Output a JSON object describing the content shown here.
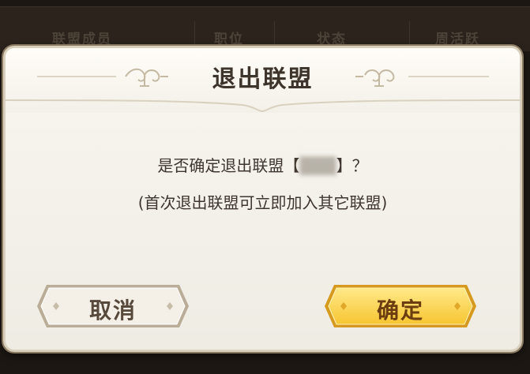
{
  "background": {
    "columns": [
      "联盟成员",
      "职位",
      "状态",
      "周活跃"
    ]
  },
  "dialog": {
    "title": "退出联盟",
    "message_prefix": "是否确定退出联盟【",
    "alliance_name": "▒▒▒",
    "message_suffix": "】？",
    "note": "(首次退出联盟可立即加入其它联盟)",
    "cancel_label": "取消",
    "confirm_label": "确定"
  },
  "colors": {
    "dialog_bg": "#f8f6f0",
    "text": "#3e362e",
    "cancel_bg": "#f3efe6",
    "confirm_bg": "#ffd85a"
  }
}
